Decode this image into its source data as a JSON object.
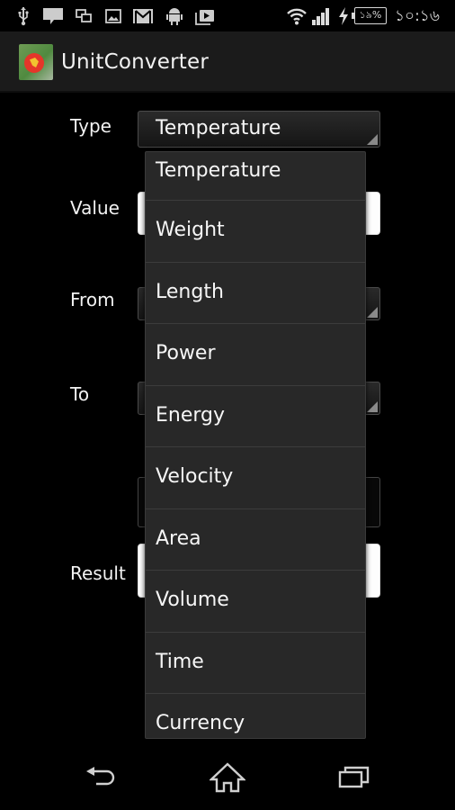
{
  "status_bar": {
    "left_icons": [
      "usb-icon",
      "message-icon",
      "windows-icon",
      "gallery-icon",
      "gmail-icon",
      "android-icon",
      "play-store-icon"
    ],
    "right_icons": [
      "wifi-icon",
      "signal-icon",
      "charging-icon"
    ],
    "battery": "১৯%",
    "time": "১০:১৬"
  },
  "action_bar": {
    "app_icon": "app-logo-icon",
    "title": "UnitConverter"
  },
  "form": {
    "type_label": "Type",
    "type_value": "Temperature",
    "value_label": "Value",
    "value_input": "",
    "from_label": "From",
    "to_label": "To",
    "result_label": "Result",
    "result_value": ""
  },
  "dropdown": {
    "options": [
      "Temperature",
      "Weight",
      "Length",
      "Power",
      "Energy",
      "Velocity",
      "Area",
      "Volume",
      "Time",
      "Currency"
    ]
  },
  "nav_bar": {
    "buttons": [
      "back-icon",
      "home-icon",
      "recent-apps-icon"
    ]
  }
}
